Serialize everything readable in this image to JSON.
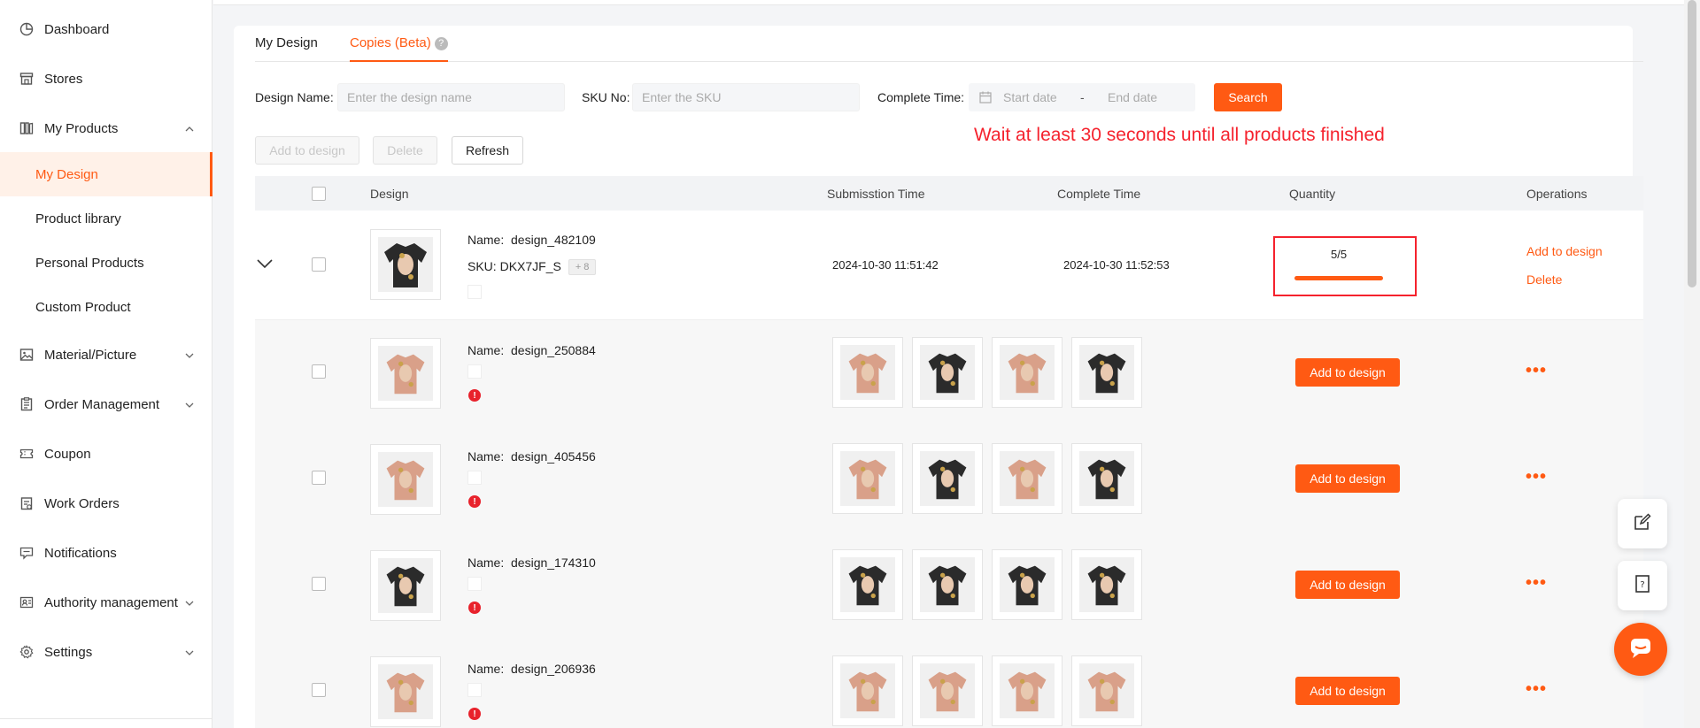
{
  "sidebar": {
    "items": [
      {
        "label": "Dashboard",
        "icon": "dashboard-icon"
      },
      {
        "label": "Stores",
        "icon": "store-icon"
      },
      {
        "label": "My Products",
        "icon": "products-icon",
        "expanded": true
      },
      {
        "label": "Material/Picture",
        "icon": "picture-icon"
      },
      {
        "label": "Order Management",
        "icon": "order-icon"
      },
      {
        "label": "Coupon",
        "icon": "coupon-icon"
      },
      {
        "label": "Work Orders",
        "icon": "work-order-icon"
      },
      {
        "label": "Notifications",
        "icon": "notification-icon"
      },
      {
        "label": "Authority management",
        "icon": "authority-icon"
      },
      {
        "label": "Settings",
        "icon": "settings-icon"
      }
    ],
    "sub_items": [
      {
        "label": "My Design",
        "active": true
      },
      {
        "label": "Product library"
      },
      {
        "label": "Personal Products"
      },
      {
        "label": "Custom Product"
      }
    ]
  },
  "tabs": [
    {
      "label": "My Design"
    },
    {
      "label": "Copies (Beta)",
      "active": true
    }
  ],
  "filters": {
    "design_name_label": "Design Name:",
    "design_name_placeholder": "Enter the design name",
    "sku_label": "SKU No:",
    "sku_placeholder": "Enter the SKU",
    "complete_time_label": "Complete Time:",
    "start_placeholder": "Start date",
    "date_separator": "-",
    "end_placeholder": "End date",
    "search_label": "Search"
  },
  "actions": {
    "add_to_design": "Add to design",
    "delete": "Delete",
    "refresh": "Refresh"
  },
  "annotation": "Wait at least 30 seconds until all products finished",
  "table": {
    "headers": [
      "Design",
      "Submisstion Time",
      "Complete Time",
      "Quantity",
      "Operations"
    ],
    "main_row": {
      "name_label": "Name:",
      "name": "design_482109",
      "sku_label": "SKU:",
      "sku": "DKX7JF_S",
      "sku_more": "+ 8",
      "submission_time": "2024-10-30 11:51:42",
      "complete_time": "2024-10-30 11:52:53",
      "quantity": "5/5",
      "progress": 1.0,
      "op_add": "Add to design",
      "op_delete": "Delete"
    },
    "sub_rows": [
      {
        "name_label": "Name:",
        "name": "design_250884",
        "button": "Add to design",
        "more": "•••"
      },
      {
        "name_label": "Name:",
        "name": "design_405456",
        "button": "Add to design",
        "more": "•••"
      },
      {
        "name_label": "Name:",
        "name": "design_174310",
        "button": "Add to design",
        "more": "•••"
      },
      {
        "name_label": "Name:",
        "name": "design_206936",
        "button": "Add to design",
        "more": "•••"
      }
    ]
  },
  "colors": {
    "accent": "#ff5a13",
    "annotation": "#f5222d",
    "error": "#e8222c"
  }
}
